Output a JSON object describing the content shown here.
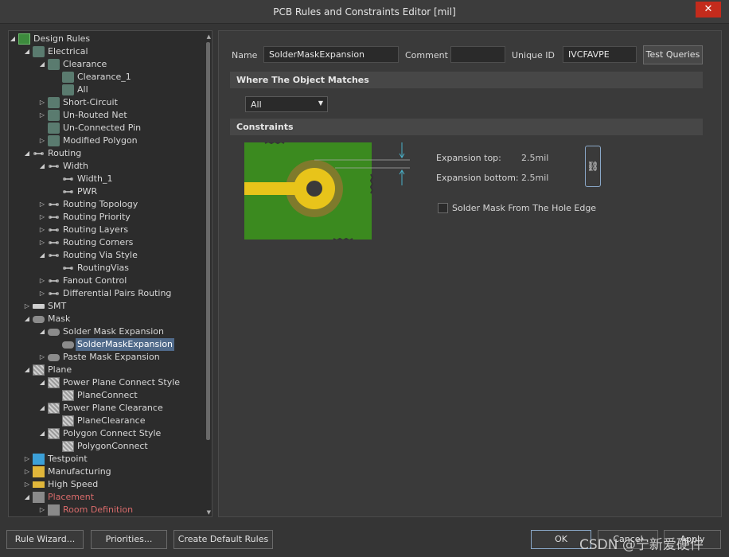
{
  "window": {
    "title": "PCB Rules and Constraints Editor [mil]",
    "close_glyph": "✕"
  },
  "tree": {
    "items": [
      {
        "label": "Design Rules",
        "level": 0,
        "arrow": "◢",
        "icon": "design-rules-icon"
      },
      {
        "label": "Electrical",
        "level": 1,
        "arrow": "◢",
        "icon": "rule-icon"
      },
      {
        "label": "Clearance",
        "level": 2,
        "arrow": "◢",
        "icon": "rule-icon"
      },
      {
        "label": "Clearance_1",
        "level": 3,
        "arrow": "",
        "icon": "rule-icon"
      },
      {
        "label": "All",
        "level": 3,
        "arrow": "",
        "icon": "rule-icon"
      },
      {
        "label": "Short-Circuit",
        "level": 2,
        "arrow": "▷",
        "icon": "rule-icon"
      },
      {
        "label": "Un-Routed Net",
        "level": 2,
        "arrow": "▷",
        "icon": "rule-icon"
      },
      {
        "label": "Un-Connected Pin",
        "level": 2,
        "arrow": "",
        "icon": "rule-icon"
      },
      {
        "label": "Modified Polygon",
        "level": 2,
        "arrow": "▷",
        "icon": "rule-icon"
      },
      {
        "label": "Routing",
        "level": 1,
        "arrow": "◢",
        "icon": "routing-icon"
      },
      {
        "label": "Width",
        "level": 2,
        "arrow": "◢",
        "icon": "routing-icon"
      },
      {
        "label": "Width_1",
        "level": 3,
        "arrow": "",
        "icon": "routing-icon"
      },
      {
        "label": "PWR",
        "level": 3,
        "arrow": "",
        "icon": "routing-icon"
      },
      {
        "label": "Routing Topology",
        "level": 2,
        "arrow": "▷",
        "icon": "routing-icon"
      },
      {
        "label": "Routing Priority",
        "level": 2,
        "arrow": "▷",
        "icon": "routing-icon"
      },
      {
        "label": "Routing Layers",
        "level": 2,
        "arrow": "▷",
        "icon": "routing-icon"
      },
      {
        "label": "Routing Corners",
        "level": 2,
        "arrow": "▷",
        "icon": "routing-icon"
      },
      {
        "label": "Routing Via Style",
        "level": 2,
        "arrow": "◢",
        "icon": "routing-icon"
      },
      {
        "label": "RoutingVias",
        "level": 3,
        "arrow": "",
        "icon": "routing-icon"
      },
      {
        "label": "Fanout Control",
        "level": 2,
        "arrow": "▷",
        "icon": "routing-icon"
      },
      {
        "label": "Differential Pairs Routing",
        "level": 2,
        "arrow": "▷",
        "icon": "routing-icon"
      },
      {
        "label": "SMT",
        "level": 1,
        "arrow": "▷",
        "icon": "smt-icon"
      },
      {
        "label": "Mask",
        "level": 1,
        "arrow": "◢",
        "icon": "mask-icon"
      },
      {
        "label": "Solder Mask Expansion",
        "level": 2,
        "arrow": "◢",
        "icon": "mask-icon"
      },
      {
        "label": "SolderMaskExpansion",
        "level": 3,
        "arrow": "",
        "icon": "mask-icon",
        "selected": true
      },
      {
        "label": "Paste Mask Expansion",
        "level": 2,
        "arrow": "▷",
        "icon": "mask-icon"
      },
      {
        "label": "Plane",
        "level": 1,
        "arrow": "◢",
        "icon": "plane-icon"
      },
      {
        "label": "Power Plane Connect Style",
        "level": 2,
        "arrow": "◢",
        "icon": "plane-icon"
      },
      {
        "label": "PlaneConnect",
        "level": 3,
        "arrow": "",
        "icon": "plane-icon"
      },
      {
        "label": "Power Plane Clearance",
        "level": 2,
        "arrow": "◢",
        "icon": "plane-icon"
      },
      {
        "label": "PlaneClearance",
        "level": 3,
        "arrow": "",
        "icon": "plane-icon"
      },
      {
        "label": "Polygon Connect Style",
        "level": 2,
        "arrow": "◢",
        "icon": "plane-icon"
      },
      {
        "label": "PolygonConnect",
        "level": 3,
        "arrow": "",
        "icon": "plane-icon"
      },
      {
        "label": "Testpoint",
        "level": 1,
        "arrow": "▷",
        "icon": "testpoint-icon"
      },
      {
        "label": "Manufacturing",
        "level": 1,
        "arrow": "▷",
        "icon": "manufacturing-icon"
      },
      {
        "label": "High Speed",
        "level": 1,
        "arrow": "▷",
        "icon": "high-speed-icon"
      },
      {
        "label": "Placement",
        "level": 1,
        "arrow": "◢",
        "icon": "placement-icon",
        "red": true
      },
      {
        "label": "Room Definition",
        "level": 2,
        "arrow": "▷",
        "icon": "placement-icon",
        "red": true
      }
    ]
  },
  "rule": {
    "name_label": "Name",
    "name_value": "SolderMaskExpansion",
    "comment_label": "Comment",
    "comment_value": "",
    "uid_label": "Unique ID",
    "uid_value": "IVCFAVPE",
    "test_queries_label": "Test Queries"
  },
  "where_section": {
    "title": "Where The Object Matches",
    "selected": "All"
  },
  "constraints_section": {
    "title": "Constraints",
    "expansion_top_label": "Expansion top:",
    "expansion_top_value": "2.5mil",
    "expansion_bottom_label": "Expansion bottom:",
    "expansion_bottom_value": "2.5mil",
    "hole_edge_label": "Solder Mask From The Hole Edge",
    "hole_edge_checked": false
  },
  "footer": {
    "rule_wizard": "Rule Wizard...",
    "priorities": "Priorities...",
    "create_default": "Create Default Rules",
    "ok": "OK",
    "cancel": "Cancel",
    "apply": "Apply",
    "watermark": "CSDN @宁新爱硬件"
  },
  "colors": {
    "pcb_green": "#3b8a1f",
    "pad_yellow": "#e8c41a",
    "selection": "#506a8a"
  }
}
